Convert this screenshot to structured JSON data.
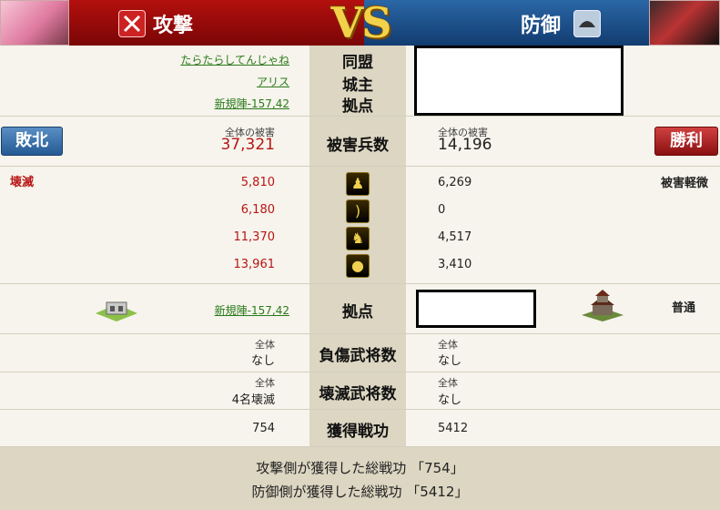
{
  "header": {
    "attack_label": "攻撃",
    "defense_label": "防御",
    "vs_label": "VS"
  },
  "alliance": {
    "label": "同盟",
    "attacker_value": "たらたらしてんじゃね"
  },
  "lord": {
    "label": "城主",
    "attacker_value": "アリス"
  },
  "base": {
    "label": "拠点",
    "attacker_value": "新規陣-157,42"
  },
  "damage": {
    "label": "被害兵数",
    "attacker_caption": "全体の被害",
    "attacker_total": "37,321",
    "defender_caption": "全体の被害",
    "defender_total": "14,196",
    "attacker_result": "敗北",
    "defender_result": "勝利"
  },
  "units": {
    "attacker_status": "壊滅",
    "defender_status": "被害軽微",
    "rows": [
      {
        "icon": "spearman-icon",
        "attacker": "5,810",
        "defender": "6,269"
      },
      {
        "icon": "bow-icon",
        "attacker": "6,180",
        "defender": "0"
      },
      {
        "icon": "horse-icon",
        "attacker": "11,370",
        "defender": "4,517"
      },
      {
        "icon": "siege-icon",
        "attacker": "13,961",
        "defender": "3,410"
      }
    ]
  },
  "base2": {
    "label": "拠点",
    "attacker_value": "新規陣-157,42",
    "defender_status": "普通"
  },
  "injured": {
    "label": "負傷武将数",
    "attacker_caption": "全体",
    "attacker_value": "なし",
    "defender_caption": "全体",
    "defender_value": "なし"
  },
  "destroyed": {
    "label": "壊滅武将数",
    "attacker_caption": "全体",
    "attacker_value": "4名壊滅",
    "defender_caption": "全体",
    "defender_value": "なし"
  },
  "merit": {
    "label": "獲得戦功",
    "attacker_value": "754",
    "defender_value": "5412"
  },
  "footer": {
    "line1": "攻撃側が獲得した総戦功 「754」",
    "line2": "防御側が獲得した総戦功 「5412」"
  },
  "colors": {
    "attack_red": "#b3100e",
    "defense_blue": "#2a67a6",
    "center_bg": "#dcd6c2"
  }
}
